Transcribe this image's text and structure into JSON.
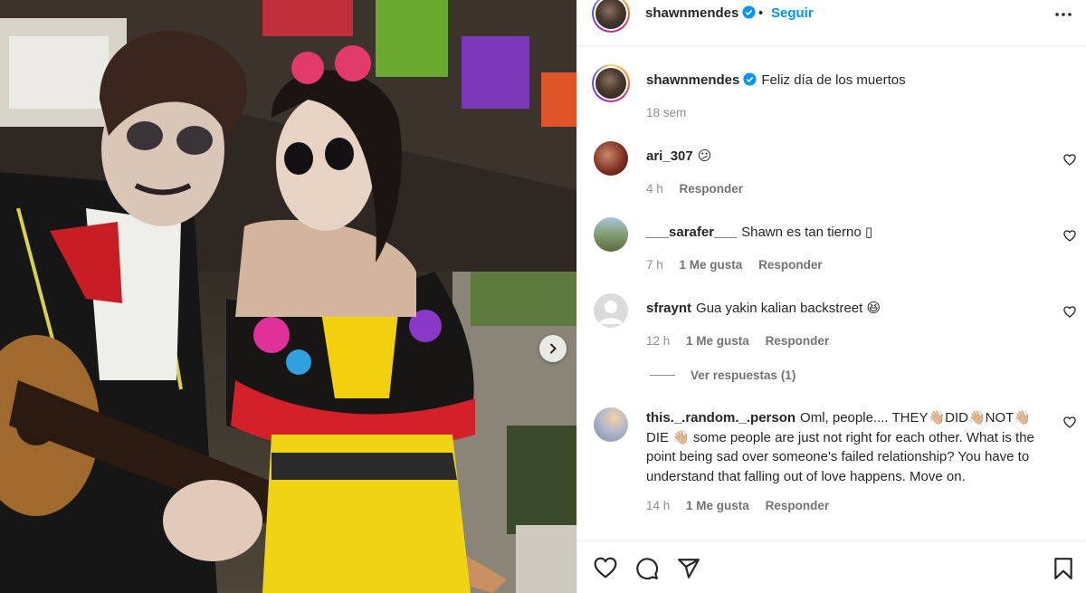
{
  "post": {
    "username": "shawnmendes",
    "follow_label": "Seguir",
    "separator": "•",
    "caption": "Feliz día de los muertos",
    "time": "18 sem"
  },
  "comments": [
    {
      "username": "ari_307",
      "text": "😕",
      "time": "4 h",
      "likes": "",
      "reply": "Responder"
    },
    {
      "username": "___sarafer___",
      "text": "Shawn es tan tierno ▯",
      "time": "7 h",
      "likes": "1 Me gusta",
      "reply": "Responder"
    },
    {
      "username": "sfraynt",
      "text": "Gua yakin kalian backstreet 😆",
      "time": "12 h",
      "likes": "1 Me gusta",
      "reply": "Responder"
    },
    {
      "username": "this._.random._.person",
      "text": "Oml, people.... THEY👋🏼DID👋🏼NOT👋🏼DIE 👋🏼 some people are just not right for each other. What is the point being sad over someone's failed relationship? You have to understand that falling out of love happens. Move on.",
      "time": "14 h",
      "likes": "1 Me gusta",
      "reply": "Responder"
    }
  ],
  "view_replies": "Ver respuestas (1)",
  "icons": {
    "verified": "verified-badge-icon",
    "more": "more-options-icon",
    "heart": "heart-icon",
    "comment": "comment-icon",
    "share": "send-icon",
    "save": "bookmark-icon",
    "next": "chevron-right-icon"
  },
  "colors": {
    "accent": "#0095f6",
    "verified": "#0095f6",
    "muted": "#8e8e8e"
  }
}
